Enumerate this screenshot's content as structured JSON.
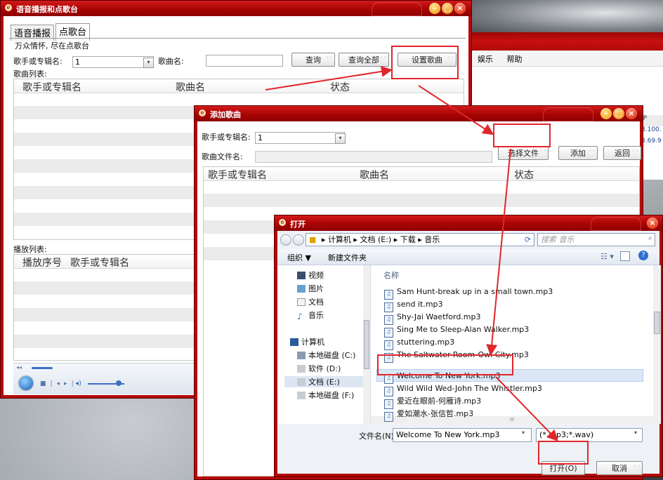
{
  "background_window": {
    "menu": [
      "娱乐",
      "帮助"
    ],
    "ip_header": "IP",
    "ip_values": [
      "8.100.",
      "8.69.9"
    ]
  },
  "main_window": {
    "title": "语音播报和点歌台",
    "tabs": [
      "语音播报",
      "点歌台"
    ],
    "slogan": "万众情怀, 尽在点歌台",
    "artist_label": "歌手或专辑名:",
    "artist_value": "1",
    "song_label": "歌曲名:",
    "song_value": "",
    "query_button": "查询",
    "query_all_button": "查询全部",
    "set_song_button": "设置歌曲",
    "song_list_label": "歌曲列表:",
    "song_columns": [
      "歌手或专辑名",
      "歌曲名",
      "状态"
    ],
    "play_list_label": "播放列表:",
    "play_columns": [
      "播放序号",
      "歌手或专辑名"
    ],
    "player_time": "◂◂"
  },
  "add_dialog": {
    "title": "添加歌曲",
    "artist_label": "歌手或专辑名:",
    "artist_value": "1",
    "file_label": "歌曲文件名:",
    "file_value": "",
    "choose_file_button": "选择文件",
    "add_button": "添加",
    "back_button": "返回",
    "columns": [
      "歌手或专辑名",
      "歌曲名",
      "状态"
    ]
  },
  "open_dialog": {
    "title": "打开",
    "breadcrumb": [
      "计算机",
      "文档 (E:)",
      "下载",
      "音乐"
    ],
    "search_placeholder": "搜索 音乐",
    "organize": "组织 ▼",
    "new_folder": "新建文件夹",
    "column_name": "名称",
    "nav_items": [
      {
        "label": "视频",
        "icon": "video-library-icon"
      },
      {
        "label": "图片",
        "icon": "pictures-library-icon"
      },
      {
        "label": "文档",
        "icon": "documents-library-icon"
      },
      {
        "label": "音乐",
        "icon": "music-library-icon"
      },
      {
        "label": "计算机",
        "icon": "computer-icon"
      },
      {
        "label": "本地磁盘 (C:)",
        "icon": "drive-icon"
      },
      {
        "label": "软件 (D:)",
        "icon": "drive-icon"
      },
      {
        "label": "文档 (E:)",
        "icon": "drive-icon"
      },
      {
        "label": "本地磁盘 (F:)",
        "icon": "drive-icon"
      }
    ],
    "files": [
      "Sam Hunt-break up in a small town.mp3",
      "send it.mp3",
      "Shy-Jai Waetford.mp3",
      "Sing Me to Sleep-Alan Walker.mp3",
      "stuttering.mp3",
      "The Saltwater Room-Owl City.mp3",
      "Welcome To New York.mp3",
      "Wild Wild Wed-John The Whistler.mp3",
      "爱近在眼前-何雁诗.mp3",
      "爱如潮水-张信哲.mp3"
    ],
    "selected_file": "Welcome To New York.mp3",
    "filename_label": "文件名(N):",
    "filename_value": "Welcome To New York.mp3",
    "filter_value": "(*.mp3;*.wav)",
    "open_button": "打开(O)",
    "cancel_button": "取消",
    "scroll_marker": "III"
  },
  "colors": {
    "title_red": "#b50a0a",
    "highlight_red": "#e0262a",
    "selection_blue": "#dbe7f7"
  }
}
